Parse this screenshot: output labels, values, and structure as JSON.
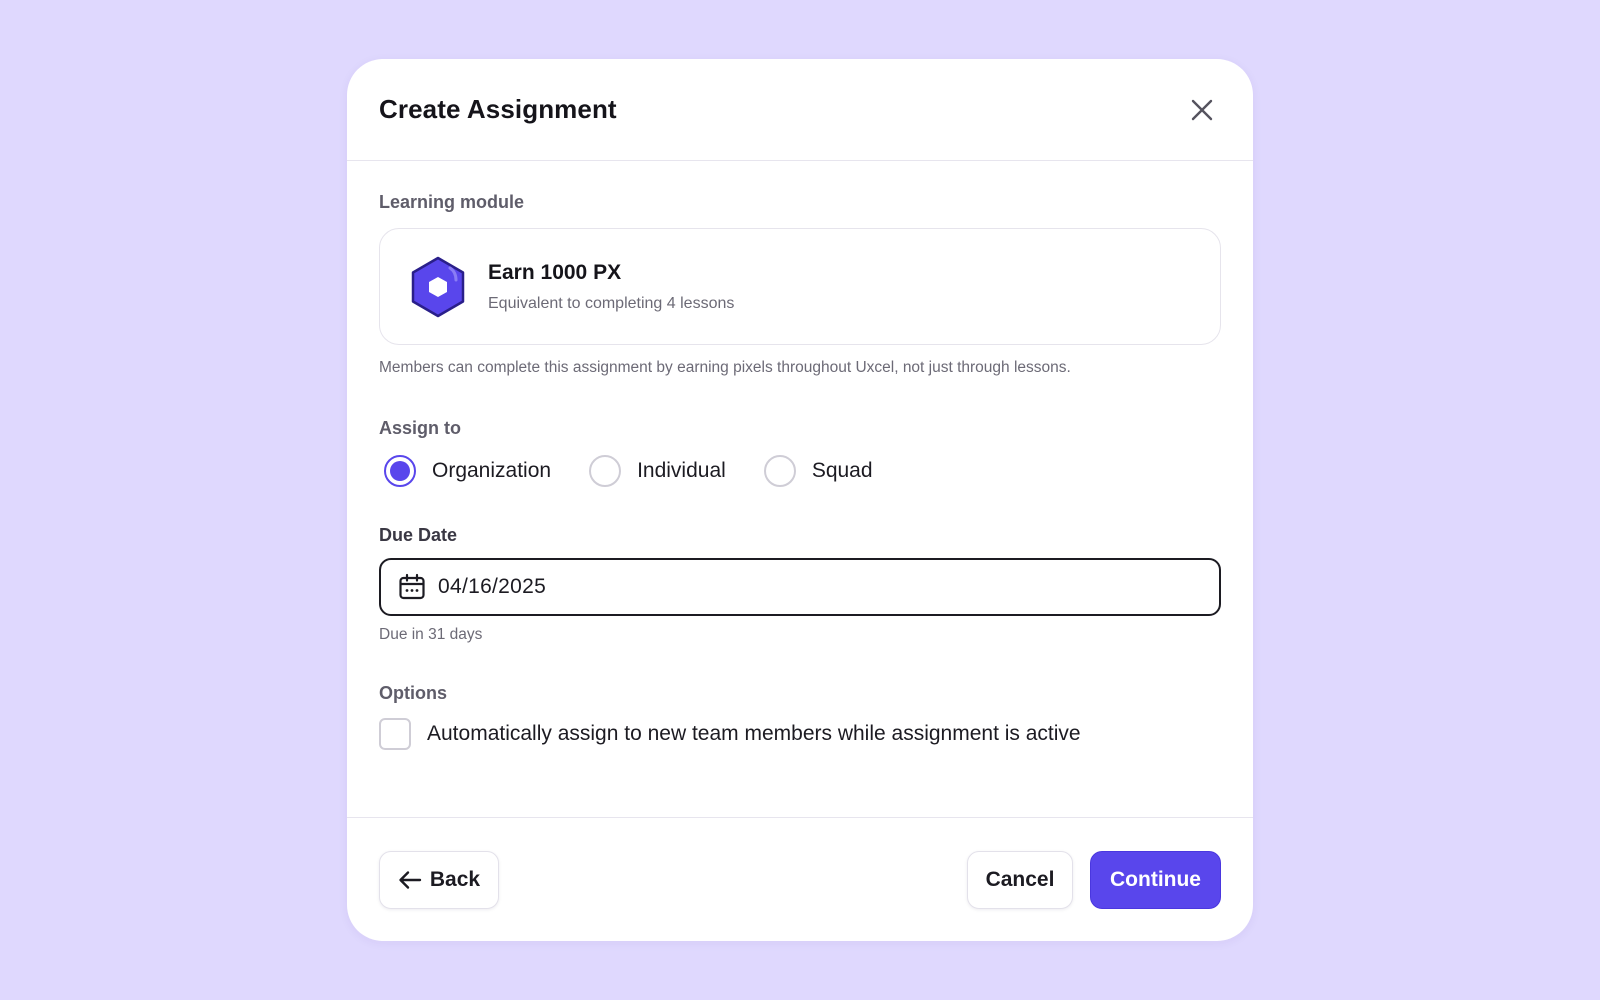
{
  "modal": {
    "title": "Create Assignment",
    "close_icon": "close-icon"
  },
  "learning_module": {
    "label": "Learning module",
    "name": "Earn 1000 PX",
    "description": "Equivalent to completing 4 lessons",
    "icon": "hexagon-badge-icon",
    "helper": "Members can complete this assignment by earning pixels throughout Uxcel, not just through lessons."
  },
  "assign_to": {
    "label": "Assign to",
    "options": [
      {
        "label": "Organization",
        "selected": true
      },
      {
        "label": "Individual",
        "selected": false
      },
      {
        "label": "Squad",
        "selected": false
      }
    ]
  },
  "due_date": {
    "label": "Due Date",
    "value": "04/16/2025",
    "icon": "calendar-icon",
    "hint": "Due in 31 days"
  },
  "options": {
    "label": "Options",
    "auto_assign_label": "Automatically assign to new team members while assignment is active",
    "auto_assign_checked": false
  },
  "footer": {
    "back_label": "Back",
    "cancel_label": "Cancel",
    "continue_label": "Continue"
  },
  "colors": {
    "background": "#dfd8fe",
    "accent": "#5946ec"
  }
}
